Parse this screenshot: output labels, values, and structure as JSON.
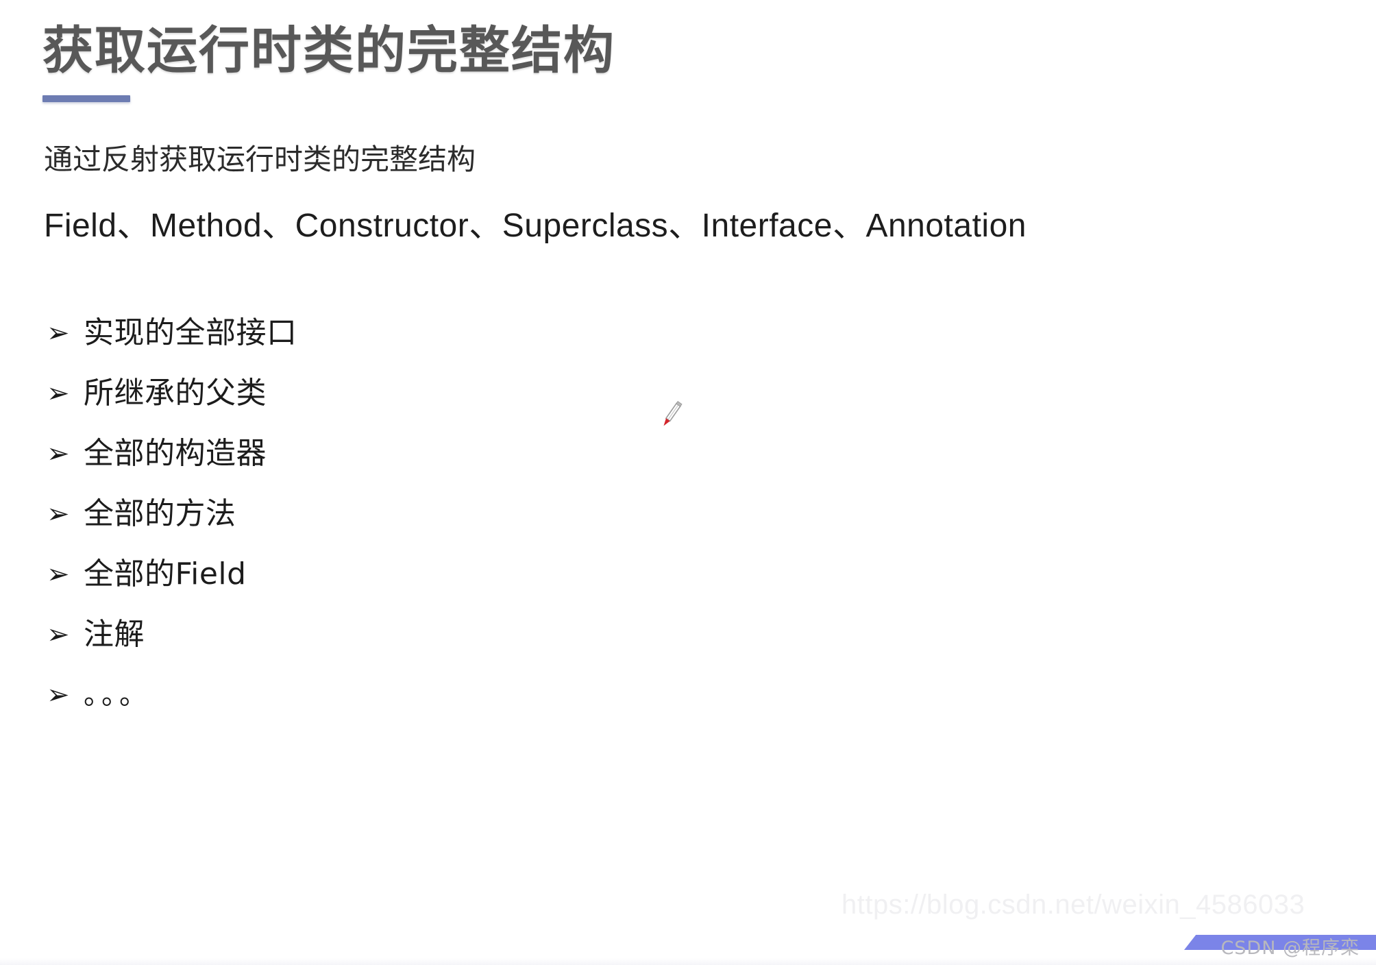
{
  "slide": {
    "title": "获取运行时类的完整结构",
    "accent_color": "#6d7cb2",
    "subtitle": "通过反射获取运行时类的完整结构",
    "api_line": "Field、Method、Constructor、Superclass、Interface、Annotation",
    "bullets": [
      {
        "marker": "➢",
        "label": "实现的全部接口"
      },
      {
        "marker": "➢",
        "label": "所继承的父类"
      },
      {
        "marker": "➢",
        "label": "全部的构造器"
      },
      {
        "marker": "➢",
        "label": "全部的方法"
      },
      {
        "marker": "➢",
        "label": "全部的Field"
      },
      {
        "marker": "➢",
        "label": "注解"
      },
      {
        "marker": "➢",
        "label": "。。。"
      }
    ]
  },
  "cursor": {
    "name": "pen-annotation-cursor",
    "tip_color": "#d3262c",
    "body_color": "#8d8d8d"
  },
  "watermark": {
    "url": "https://blog.csdn.net/weixin_4586033",
    "brand": "CSDN @程序栾",
    "bar_color": "#7b84e8"
  }
}
